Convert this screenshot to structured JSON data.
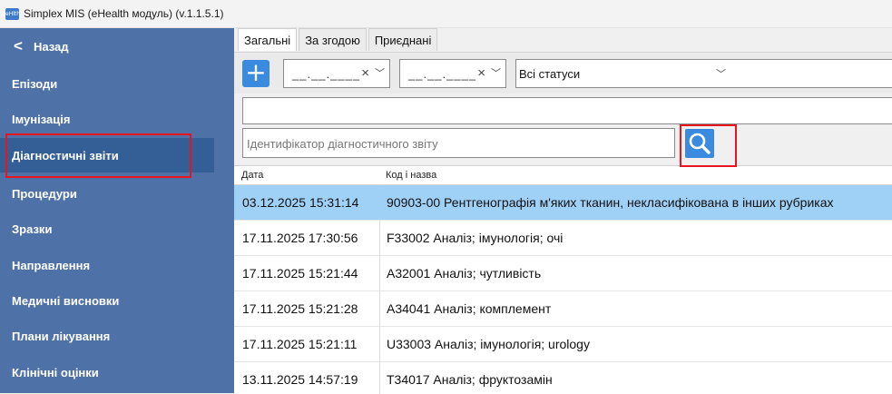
{
  "window": {
    "title": "Simplex MIS (eHealth модуль) (v.1.1.5.1)",
    "app_icon_text": "eHlth"
  },
  "sidebar": {
    "back_label": "Назад",
    "items": [
      {
        "label": "Епізоди"
      },
      {
        "label": "Імунізація"
      },
      {
        "label": "Діагностичні звіти",
        "active": true
      },
      {
        "label": "Процедури"
      },
      {
        "label": "Зразки"
      },
      {
        "label": "Направлення"
      },
      {
        "label": "Медичні висновки"
      },
      {
        "label": "Плани лікування"
      },
      {
        "label": "Клінічні оцінки"
      }
    ]
  },
  "tabs": [
    {
      "label": "Загальні",
      "active": true
    },
    {
      "label": "За згодою"
    },
    {
      "label": "Приєднані"
    }
  ],
  "filters": {
    "date_from": "__.__.____",
    "date_to": "__.__.____",
    "status": "Всі статуси"
  },
  "search": {
    "placeholder": "Ідентифікатор діагностичного звіту"
  },
  "table": {
    "columns": [
      "Дата",
      "Код і назва"
    ],
    "rows": [
      {
        "date": "03.12.2025 15:31:14",
        "name": "90903-00 Рентгенографія м'яких тканин, некласифікована в інших рубриках",
        "selected": true
      },
      {
        "date": "17.11.2025 17:30:56",
        "name": "F33002 Аналіз; імунологія; очі"
      },
      {
        "date": "17.11.2025 15:21:44",
        "name": "A32001 Аналіз; чутливість"
      },
      {
        "date": "17.11.2025 15:21:28",
        "name": "A34041 Аналіз; комплемент"
      },
      {
        "date": "17.11.2025 15:21:11",
        "name": "U33003 Аналіз; імунологія; urology"
      },
      {
        "date": "13.11.2025 14:57:19",
        "name": "T34017 Аналіз; фруктозамін"
      }
    ]
  },
  "colors": {
    "sidebar": "#4e72a8",
    "active_item": "#345f96",
    "accent": "#3a8ae0",
    "selection": "#9fd1f7",
    "highlight": "#e8141e"
  }
}
